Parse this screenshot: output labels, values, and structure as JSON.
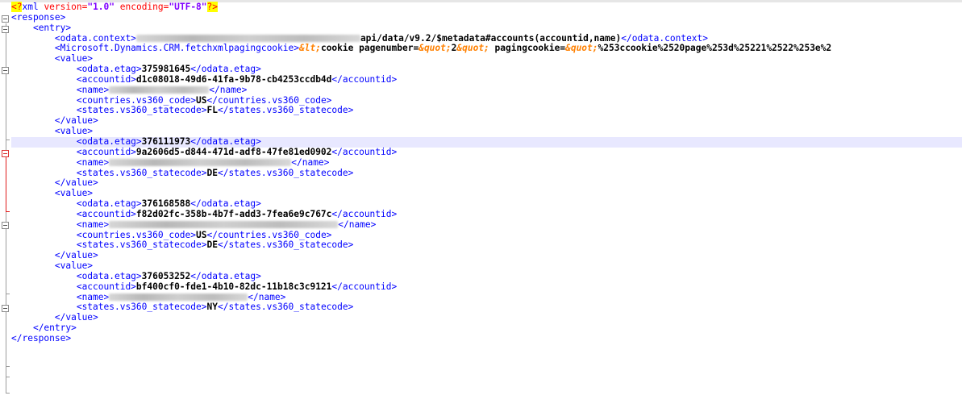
{
  "editor": {
    "xml_decl": {
      "open": "<?",
      "xml": "xml",
      "v_attr": " version=",
      "version": "\"1.0\"",
      "e_attr": " encoding=",
      "encoding": "\"UTF-8\"",
      "close": "?>"
    },
    "lines": {
      "response_open": "<response>",
      "entry_open": "<entry>",
      "context_open": "<odata.context>",
      "context_value": "api/data/v9.2/$metadata#accounts(accountid,name)",
      "context_close": "</odata.context>",
      "cookie_open": "<Microsoft.Dynamics.CRM.fetchxmlpagingcookie>",
      "cookie_ent1": "&lt;",
      "cookie_txt1": "cookie pagenumber=",
      "cookie_ent2": "&quot;",
      "cookie_txt2": "2",
      "cookie_ent3": "&quot;",
      "cookie_txt3": " pagingcookie=",
      "cookie_ent4": "&quot;",
      "cookie_txt4": "%253ccookie%2520page%253d%25221%2522%253e%2",
      "value_open": "<value>",
      "value_close": "</value>",
      "entry_close": "</entry>",
      "response_close": "</response>",
      "etag_open": "<odata.etag>",
      "etag_close": "</odata.etag>",
      "accountid_open": "<accountid>",
      "accountid_close": "</accountid>",
      "name_open": "<name>",
      "name_close": "</name>",
      "countries_open": "<countries.vs360_code>",
      "countries_close": "</countries.vs360_code>",
      "states_open": "<states.vs360_statecode>",
      "states_close": "</states.vs360_statecode>"
    },
    "records": [
      {
        "etag": "375981645",
        "accountid": "d1c08018-49d6-41fa-9b78-cb4253ccdb4d",
        "country": "US",
        "state": "FL"
      },
      {
        "etag": "376111973",
        "accountid": "9a2606d5-d844-471d-adf8-47fe81ed0902",
        "state": "DE"
      },
      {
        "etag": "376168588",
        "accountid": "f82d02fc-358b-4b7f-add3-7fea6e9c767c",
        "country": "US",
        "state": "DE"
      },
      {
        "etag": "376053252",
        "accountid": "bf400cf0-fde1-4b10-82dc-11b18c3c9121",
        "state": "NY"
      }
    ]
  }
}
